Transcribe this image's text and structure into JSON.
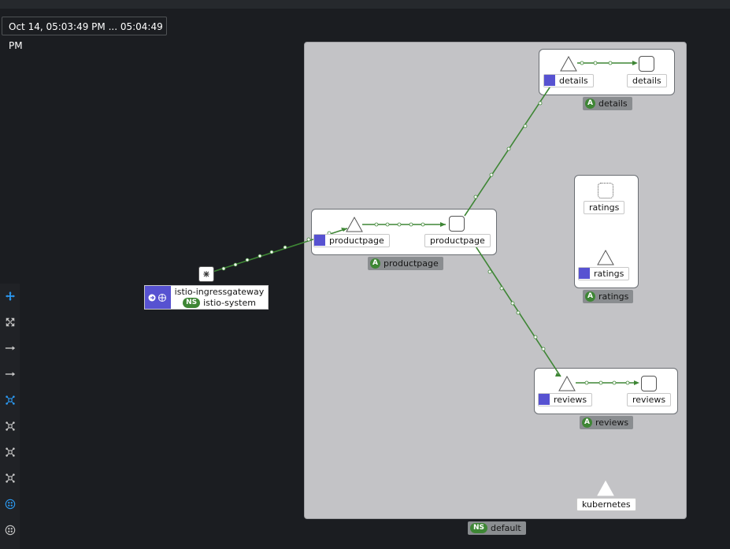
{
  "topbar": {},
  "time_range": {
    "label": "Oct 14, 05:03:49 PM ... 05:04:49 PM"
  },
  "toolbar": {
    "buttons": [
      {
        "name": "pan-icon",
        "active": true
      },
      {
        "name": "fit-icon",
        "active": false
      },
      {
        "name": "edge-arrow-icon",
        "active": false
      },
      {
        "name": "edge-arrow-2-icon",
        "active": false
      },
      {
        "name": "layout-default-icon",
        "active": true
      },
      {
        "name": "layout-1-icon",
        "active": false
      },
      {
        "name": "layout-2-icon",
        "active": false
      },
      {
        "name": "layout-3-icon",
        "active": false
      },
      {
        "name": "namespace-layout-icon",
        "active": true
      },
      {
        "name": "namespace-layout-2-icon",
        "active": false
      }
    ]
  },
  "colors": {
    "background": "#1b1d21",
    "namespace_box": "#c3c3c6",
    "edge": "#3e8635",
    "badge": "#3e8635",
    "version_icon": "#5752d1",
    "active_tool": "#2b9af3"
  },
  "gateway": {
    "workload": "istio-ingressgateway",
    "namespace_badge": "NS",
    "namespace": "istio-system"
  },
  "namespace": {
    "badge": "NS",
    "name": "default"
  },
  "apps": {
    "productpage": {
      "badge": "A",
      "group_label": "productpage",
      "workload_label": "productpage",
      "service_label": "productpage"
    },
    "details": {
      "badge": "A",
      "group_label": "details",
      "workload_label": "details",
      "service_label": "details"
    },
    "ratings": {
      "badge": "A",
      "group_label": "ratings",
      "workload_label": "ratings",
      "service_label": "ratings"
    },
    "reviews": {
      "badge": "A",
      "group_label": "reviews",
      "workload_label": "reviews",
      "service_label": "reviews"
    }
  },
  "kubernetes": {
    "label": "kubernetes"
  }
}
